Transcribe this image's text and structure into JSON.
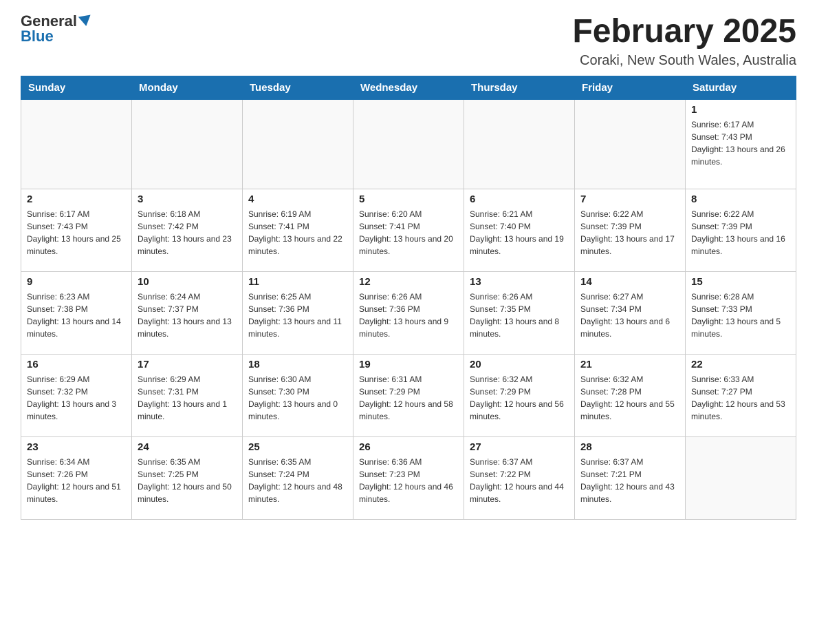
{
  "header": {
    "logo_general": "General",
    "logo_blue": "Blue",
    "month_title": "February 2025",
    "location": "Coraki, New South Wales, Australia"
  },
  "days_of_week": [
    "Sunday",
    "Monday",
    "Tuesday",
    "Wednesday",
    "Thursday",
    "Friday",
    "Saturday"
  ],
  "weeks": [
    [
      {
        "day": "",
        "info": ""
      },
      {
        "day": "",
        "info": ""
      },
      {
        "day": "",
        "info": ""
      },
      {
        "day": "",
        "info": ""
      },
      {
        "day": "",
        "info": ""
      },
      {
        "day": "",
        "info": ""
      },
      {
        "day": "1",
        "info": "Sunrise: 6:17 AM\nSunset: 7:43 PM\nDaylight: 13 hours and 26 minutes."
      }
    ],
    [
      {
        "day": "2",
        "info": "Sunrise: 6:17 AM\nSunset: 7:43 PM\nDaylight: 13 hours and 25 minutes."
      },
      {
        "day": "3",
        "info": "Sunrise: 6:18 AM\nSunset: 7:42 PM\nDaylight: 13 hours and 23 minutes."
      },
      {
        "day": "4",
        "info": "Sunrise: 6:19 AM\nSunset: 7:41 PM\nDaylight: 13 hours and 22 minutes."
      },
      {
        "day": "5",
        "info": "Sunrise: 6:20 AM\nSunset: 7:41 PM\nDaylight: 13 hours and 20 minutes."
      },
      {
        "day": "6",
        "info": "Sunrise: 6:21 AM\nSunset: 7:40 PM\nDaylight: 13 hours and 19 minutes."
      },
      {
        "day": "7",
        "info": "Sunrise: 6:22 AM\nSunset: 7:39 PM\nDaylight: 13 hours and 17 minutes."
      },
      {
        "day": "8",
        "info": "Sunrise: 6:22 AM\nSunset: 7:39 PM\nDaylight: 13 hours and 16 minutes."
      }
    ],
    [
      {
        "day": "9",
        "info": "Sunrise: 6:23 AM\nSunset: 7:38 PM\nDaylight: 13 hours and 14 minutes."
      },
      {
        "day": "10",
        "info": "Sunrise: 6:24 AM\nSunset: 7:37 PM\nDaylight: 13 hours and 13 minutes."
      },
      {
        "day": "11",
        "info": "Sunrise: 6:25 AM\nSunset: 7:36 PM\nDaylight: 13 hours and 11 minutes."
      },
      {
        "day": "12",
        "info": "Sunrise: 6:26 AM\nSunset: 7:36 PM\nDaylight: 13 hours and 9 minutes."
      },
      {
        "day": "13",
        "info": "Sunrise: 6:26 AM\nSunset: 7:35 PM\nDaylight: 13 hours and 8 minutes."
      },
      {
        "day": "14",
        "info": "Sunrise: 6:27 AM\nSunset: 7:34 PM\nDaylight: 13 hours and 6 minutes."
      },
      {
        "day": "15",
        "info": "Sunrise: 6:28 AM\nSunset: 7:33 PM\nDaylight: 13 hours and 5 minutes."
      }
    ],
    [
      {
        "day": "16",
        "info": "Sunrise: 6:29 AM\nSunset: 7:32 PM\nDaylight: 13 hours and 3 minutes."
      },
      {
        "day": "17",
        "info": "Sunrise: 6:29 AM\nSunset: 7:31 PM\nDaylight: 13 hours and 1 minute."
      },
      {
        "day": "18",
        "info": "Sunrise: 6:30 AM\nSunset: 7:30 PM\nDaylight: 13 hours and 0 minutes."
      },
      {
        "day": "19",
        "info": "Sunrise: 6:31 AM\nSunset: 7:29 PM\nDaylight: 12 hours and 58 minutes."
      },
      {
        "day": "20",
        "info": "Sunrise: 6:32 AM\nSunset: 7:29 PM\nDaylight: 12 hours and 56 minutes."
      },
      {
        "day": "21",
        "info": "Sunrise: 6:32 AM\nSunset: 7:28 PM\nDaylight: 12 hours and 55 minutes."
      },
      {
        "day": "22",
        "info": "Sunrise: 6:33 AM\nSunset: 7:27 PM\nDaylight: 12 hours and 53 minutes."
      }
    ],
    [
      {
        "day": "23",
        "info": "Sunrise: 6:34 AM\nSunset: 7:26 PM\nDaylight: 12 hours and 51 minutes."
      },
      {
        "day": "24",
        "info": "Sunrise: 6:35 AM\nSunset: 7:25 PM\nDaylight: 12 hours and 50 minutes."
      },
      {
        "day": "25",
        "info": "Sunrise: 6:35 AM\nSunset: 7:24 PM\nDaylight: 12 hours and 48 minutes."
      },
      {
        "day": "26",
        "info": "Sunrise: 6:36 AM\nSunset: 7:23 PM\nDaylight: 12 hours and 46 minutes."
      },
      {
        "day": "27",
        "info": "Sunrise: 6:37 AM\nSunset: 7:22 PM\nDaylight: 12 hours and 44 minutes."
      },
      {
        "day": "28",
        "info": "Sunrise: 6:37 AM\nSunset: 7:21 PM\nDaylight: 12 hours and 43 minutes."
      },
      {
        "day": "",
        "info": ""
      }
    ]
  ]
}
